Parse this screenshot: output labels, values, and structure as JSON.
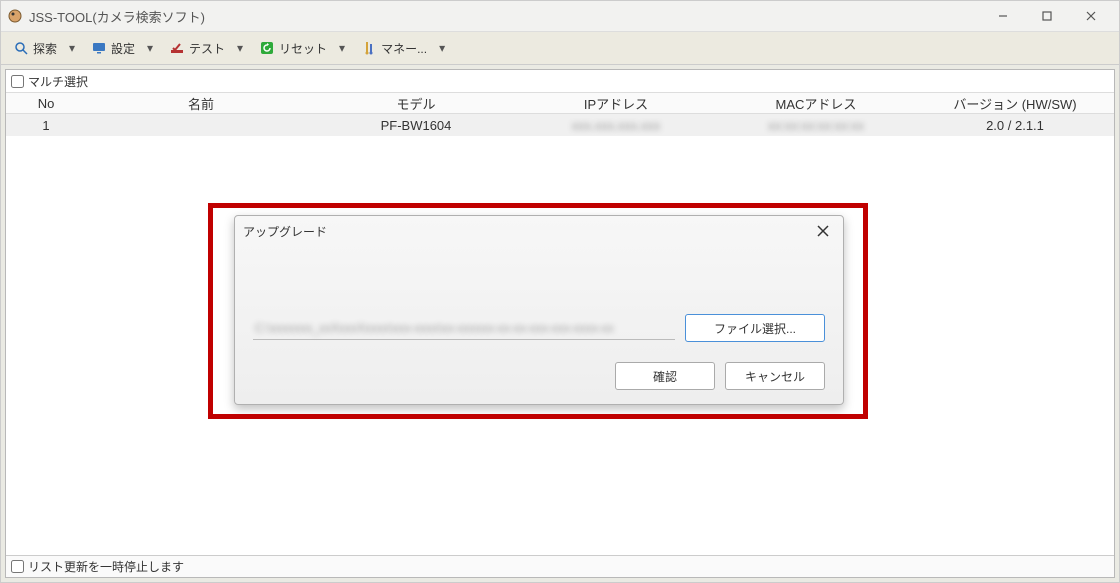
{
  "window": {
    "title": "JSS-TOOL(カメラ検索ソフト)"
  },
  "toolbar": {
    "explore": "探索",
    "settings": "設定",
    "test": "テスト",
    "reset": "リセット",
    "manager": "マネー..."
  },
  "multi_select": {
    "label": "マルチ選択"
  },
  "table": {
    "columns": {
      "no": "No",
      "name": "名前",
      "model": "モデル",
      "ip": "IPアドレス",
      "mac": "MACアドレス",
      "ver": "バージョン (HW/SW)"
    },
    "rows": [
      {
        "no": "1",
        "name": "",
        "model": "PF-BW1604",
        "ip": "xxx.xxx.xxx.xxx",
        "mac": "xx:xx:xx:xx:xx:xx",
        "ver": "2.0 / 2.1.1"
      }
    ]
  },
  "dialog": {
    "title": "アップグレード",
    "file_path_masked": "C:\\xxxxxxx_xxXxxxXxxxx\\xxx-xxxx\\xx-xxxxxx-xx-xx-xxx-xxx-xxxx-xx",
    "file_select": "ファイル選択...",
    "confirm": "確認",
    "cancel": "キャンセル"
  },
  "status": {
    "pause_label": "リスト更新を一時停止します"
  }
}
